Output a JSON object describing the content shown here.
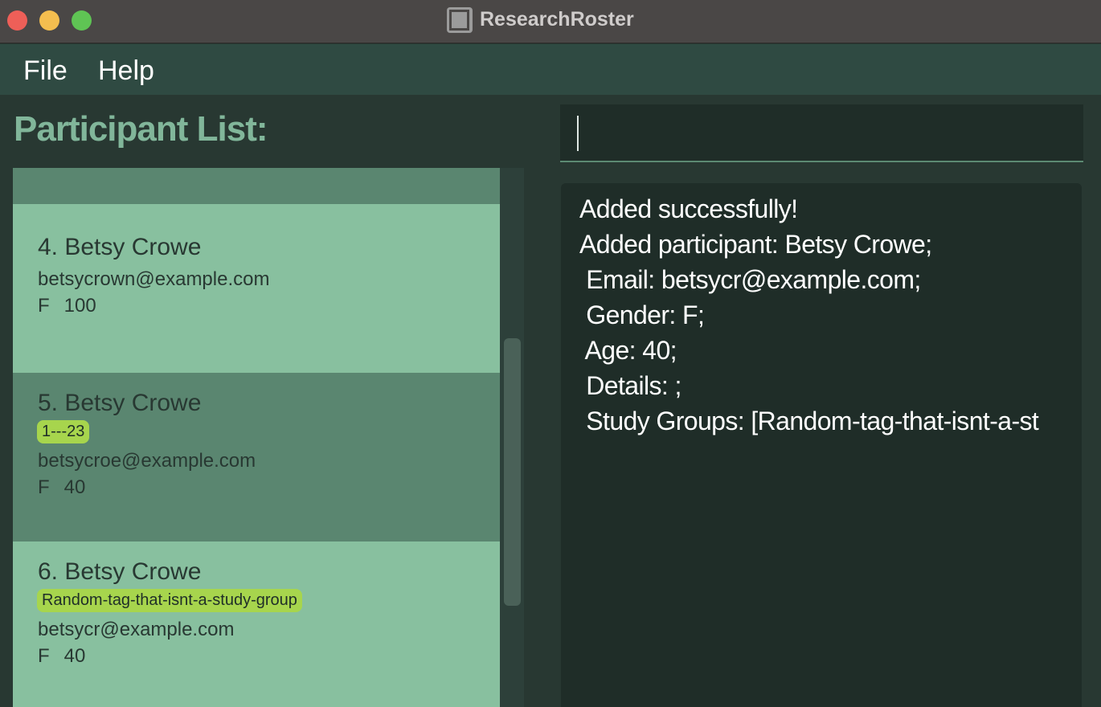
{
  "window": {
    "title": "ResearchRoster",
    "logo_text": "RR"
  },
  "menu": {
    "items": [
      {
        "label": "File"
      },
      {
        "label": "Help"
      }
    ]
  },
  "participant_panel": {
    "title": "Participant List:",
    "participants": [
      {
        "name": "4. Betsy Crowe",
        "tags": [],
        "email": "betsycrown@example.com",
        "gender": "F",
        "age": "100"
      },
      {
        "name": "5. Betsy Crowe",
        "tags": [
          "1---23"
        ],
        "email": "betsycroe@example.com",
        "gender": "F",
        "age": "40"
      },
      {
        "name": "6. Betsy Crowe",
        "tags": [
          "Random-tag-that-isnt-a-study-group"
        ],
        "email": "betsycr@example.com",
        "gender": "F",
        "age": "40"
      }
    ]
  },
  "command": {
    "value": "",
    "placeholder": ""
  },
  "result": {
    "lines": [
      "Added successfully!",
      "Added participant: Betsy Crowe;",
      " Email: betsycr@example.com;",
      " Gender: F;",
      " Age: 40;",
      " Details: ;",
      " Study Groups: [Random-tag-that-isnt-a-st"
    ]
  },
  "colors": {
    "card_light": "#88c09f",
    "card_selected": "#5a8670",
    "tag": "#a7d54d",
    "result_background": "#1f2d28",
    "panel_title": "#81b69a"
  }
}
